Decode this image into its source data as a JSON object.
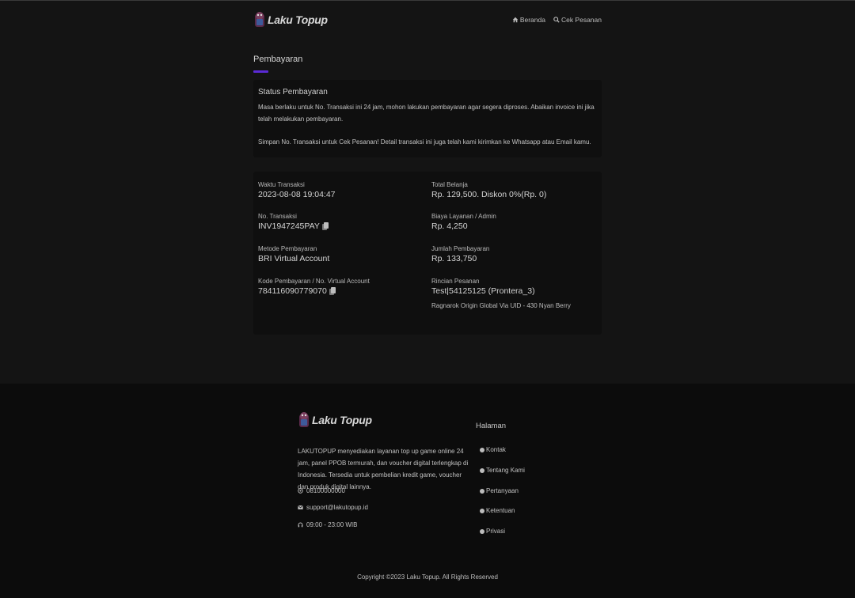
{
  "brand": {
    "name": "Laku Topup"
  },
  "nav": {
    "home_label": "Beranda",
    "check_label": "Cek Pesanan"
  },
  "page": {
    "title": "Pembayaran"
  },
  "status": {
    "title": "Status Pembayaran",
    "text1": "Masa berlaku untuk No. Transaksi ini 24 jam, mohon lakukan pembayaran agar segera diproses. Abaikan invoice ini jika telah melakukan pembayaran.",
    "text2": "Simpan No. Transaksi untuk Cek Pesanan! Detail transaksi ini juga telah kami kirimkan ke Whatsapp atau Email kamu."
  },
  "details": {
    "time_label": "Waktu Transaksi",
    "time_value": "2023-08-08 19:04:47",
    "invoice_label": "No. Transaksi",
    "invoice_value": "INV1947245PAY",
    "method_label": "Metode Pembayaran",
    "method_value": "BRI Virtual Account",
    "va_label": "Kode Pembayaran / No. Virtual Account",
    "va_value": "784116090779070",
    "total_label": "Total Belanja",
    "total_value": "Rp. 129,500. Diskon 0%(Rp. 0)",
    "fee_label": "Biaya Layanan / Admin",
    "fee_value": "Rp. 4,250",
    "amount_label": "Jumlah Pembayaran",
    "amount_value": "Rp. 133,750",
    "order_label": "Rincian Pesanan",
    "order_value": "Test|54125125 (Prontera_3)",
    "order_sub": "Ragnarok Origin Global Via UID - 430 Nyan Berry"
  },
  "footer": {
    "description": "LAKUTOPUP menyediakan layanan top up game online 24 jam, panel PPOB termurah, dan voucher digital terlengkap di Indonesia. Tersedia untuk pembelian kredit game, voucher dan produk digital lainnya.",
    "phone": "08100000000",
    "email": "support@lakutopup.id",
    "hours": "09:00 - 23:00 WIB",
    "links_heading": "Halaman",
    "links": [
      "Kontak",
      "Tentang Kami",
      "Pertanyaan",
      "Ketentuan",
      "Privasi"
    ],
    "copyright": "Copyright ©2023 Laku Topup. All Rights Reserved"
  },
  "icons": {
    "home": "home-icon",
    "search": "search-icon",
    "copy": "copy-icon",
    "whatsapp": "whatsapp-icon",
    "email": "envelope-icon",
    "headset": "headset-icon",
    "link_bullet": "circle-arrow-icon"
  },
  "colors": {
    "accent": "#5b2bd6",
    "background": "#141414",
    "card": "#0f0f0f",
    "footer": "#0c0c0c"
  }
}
